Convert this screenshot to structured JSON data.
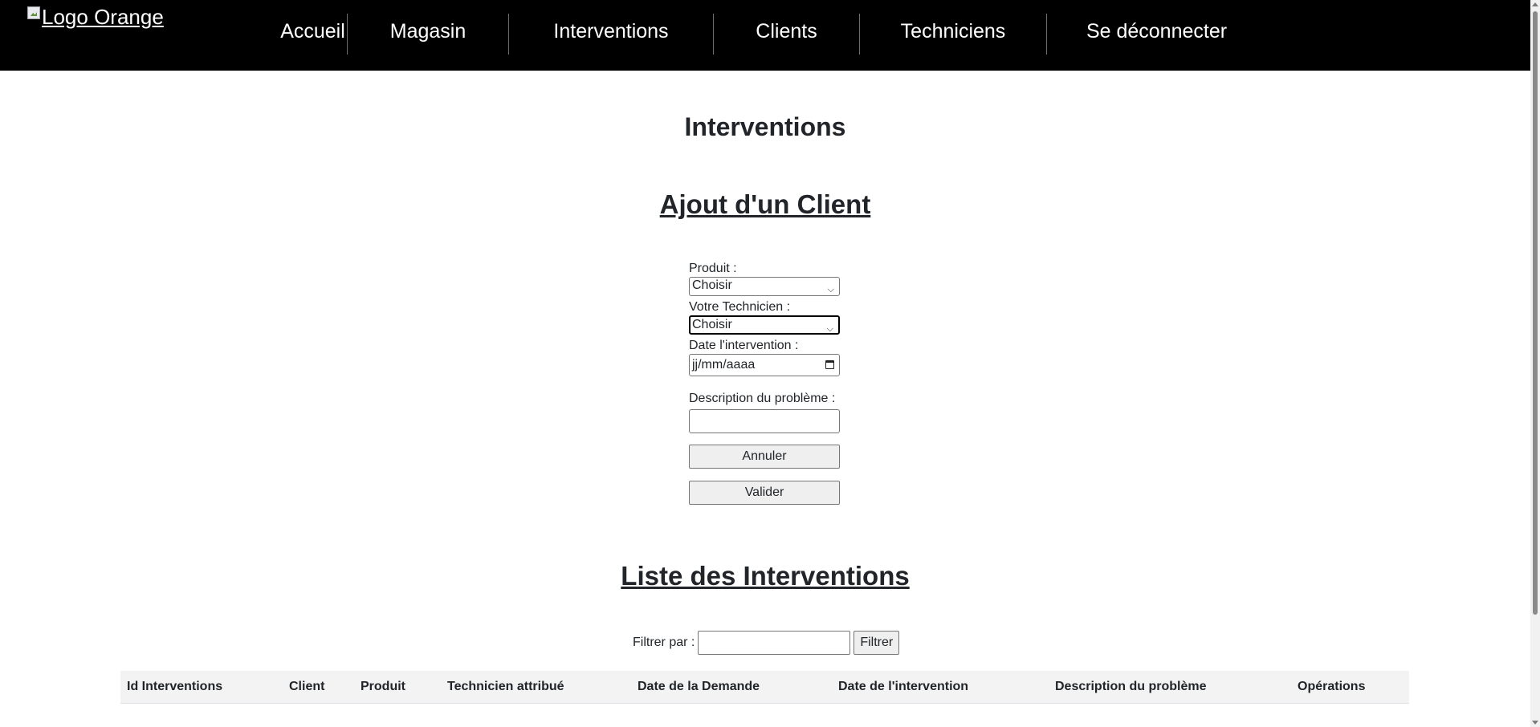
{
  "navbar": {
    "logo_alt": "Logo Orange",
    "items": [
      {
        "label": "Accueil"
      },
      {
        "label": "Magasin"
      },
      {
        "label": "Interventions"
      },
      {
        "label": "Clients"
      },
      {
        "label": "Techniciens"
      },
      {
        "label": "Se déconnecter"
      }
    ],
    "background_color": "#000000",
    "text_color": "#ffffff"
  },
  "page": {
    "title": "Interventions"
  },
  "form": {
    "heading": "Ajout d'un Client",
    "produit_label": "Produit :",
    "produit_value": "Choisir",
    "technicien_label": "Votre Technicien :",
    "technicien_value": "Choisir",
    "date_label": "Date l'intervention :",
    "date_placeholder": "jj/mm/aaaa",
    "description_label": "Description du problème :",
    "description_value": "",
    "cancel_label": "Annuler",
    "submit_label": "Valider"
  },
  "list": {
    "heading": "Liste des Interventions",
    "filter_label": "Filtrer par :",
    "filter_value": "",
    "filter_button": "Filtrer",
    "columns": [
      "Id Interventions",
      "Client",
      "Produit",
      "Technicien attribué",
      "Date de la Demande",
      "Date de l'intervention",
      "Description du problème",
      "Opérations"
    ],
    "rows": []
  }
}
